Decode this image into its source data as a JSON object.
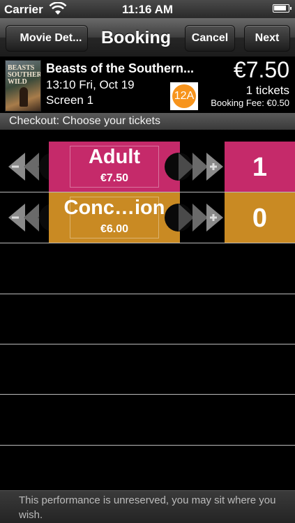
{
  "status_bar": {
    "carrier": "Carrier",
    "time": "11:16 AM",
    "battery_level": 0.9
  },
  "nav": {
    "back_label": "Movie Det...",
    "title": "Booking",
    "cancel_label": "Cancel",
    "next_label": "Next"
  },
  "film": {
    "poster_text": "BEASTS SOUTHERN WILD",
    "title": "Beasts of the Southern...",
    "time": "13:10 Fri, Oct 19",
    "screen": "Screen 1",
    "rating": "12A",
    "total_price": "€7.50",
    "ticket_count": "1 tickets",
    "booking_fee": "Booking Fee: €0.50"
  },
  "checkout_header": "Checkout: Choose your tickets",
  "ticket_types": [
    {
      "name": "Adult",
      "price": "€7.50",
      "quantity": "1",
      "color": "#c52a6a"
    },
    {
      "name": "Conc…ion",
      "price": "€6.00",
      "quantity": "0",
      "color": "#c98a23"
    }
  ],
  "footer_text": "This performance is unreserved, you may sit where you wish.",
  "colors": {
    "adult_accent": "#c52a6a",
    "concession_accent": "#c98a23",
    "rating_badge": "#f7941d"
  }
}
